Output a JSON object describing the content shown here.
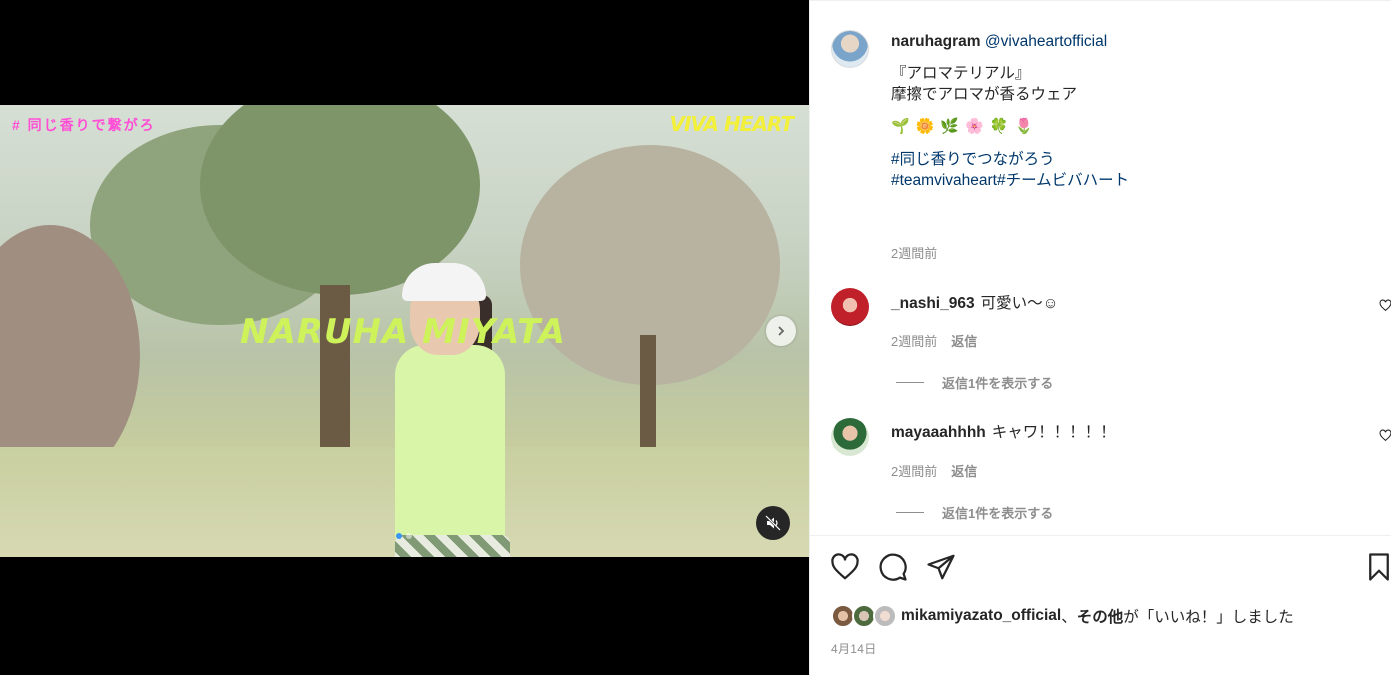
{
  "media": {
    "overlay_hashtag": "# 同じ香りで繋がろ",
    "brand_logo_text": "VIVA HEART",
    "overlay_title": "NARUHA MIYATA",
    "carousel": {
      "total": 2,
      "current": 1
    },
    "next_icon": "chevron-right-icon",
    "mute_icon": "speaker-muted-icon"
  },
  "post": {
    "author": "naruhagram",
    "mention": "@vivaheartofficial",
    "caption_line1": "『アロマテリアル』",
    "caption_line2": "摩擦でアロマが香るウェア",
    "emojis": [
      "🌱",
      "🌼",
      "🌿",
      "🌸",
      "🍀",
      "🌷"
    ],
    "hashtag1": "#同じ香りでつながろう",
    "hashtag2": "#teamvivaheart",
    "hashtag3": "#チームビバハート",
    "caption_time": "2週間前"
  },
  "comments": [
    {
      "user": "_nashi_963",
      "text": "可愛い〜☺︎",
      "time": "2週間前",
      "reply_label": "返信",
      "view_replies": "返信1件を表示する"
    },
    {
      "user": "mayaaahhhh",
      "text": "キャワ！！！！！",
      "time": "2週間前",
      "reply_label": "返信",
      "view_replies": "返信1件を表示する"
    }
  ],
  "actions": {
    "icons": [
      "heart-icon",
      "comment-icon",
      "share-icon",
      "bookmark-icon"
    ]
  },
  "likes": {
    "liker": "mikamiyazato_official",
    "separator": "、",
    "others": "その他",
    "suffix": "が「いいね！」しました"
  },
  "post_date": "4月14日",
  "colors": {
    "link": "#00376b",
    "muted": "#8e8e8e",
    "overlay_title": "#cdf25a",
    "overlay_hashtag": "#ff4fd6",
    "carousel_active": "#3a95f0"
  }
}
